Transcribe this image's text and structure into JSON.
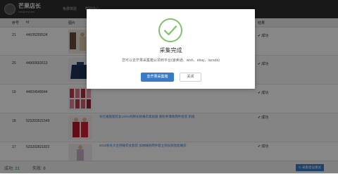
{
  "nav": {
    "brand_name": "芒果店长",
    "brand_sub": "mangoerp.com",
    "items": [
      {
        "label": "免费体验"
      },
      {
        "label": "帮助中心"
      }
    ]
  },
  "table": {
    "headers": {
      "seq": "序号",
      "id": "Id",
      "image": "图片",
      "result": "结果"
    },
    "rows": [
      {
        "seq": "21",
        "id": "44035255524",
        "title": "",
        "status": "成功"
      },
      {
        "seq": "20",
        "id": "44900692613",
        "title": "",
        "status": "成功"
      },
      {
        "seq": "19",
        "id": "44604546644",
        "title": "",
        "status": "成功"
      },
      {
        "seq": "18",
        "id": "523203521549",
        "title": "冬红婚服套装女100%纯棉长款睡衣家居服 春秋季薄款两件套装 新娘",
        "status": "成功"
      },
      {
        "seq": "17",
        "id": "523202821822",
        "title": "2015秋冬大主持睡衣女套装 加绒睡袍两件套立领长款宽松睡衣",
        "status": "成功"
      }
    ]
  },
  "footer": {
    "success_label": "成功:",
    "success_count": "21",
    "fail_label": "失败:",
    "fail_count": "0",
    "button_label": "采集错误重试"
  },
  "modal": {
    "title": "采集完成",
    "description": "您可以去芒果采集箱认领到平台(速卖通、wish、ebay、lazada)",
    "primary_button": "去芒果采集箱",
    "close_button": "关闭"
  },
  "colors": {
    "nav_bg": "#2f2f2f",
    "accent_blue": "#3a7bc8",
    "success_green": "#5cb85c",
    "fail_red": "#d9534f",
    "check_green": "#7ec26b"
  }
}
